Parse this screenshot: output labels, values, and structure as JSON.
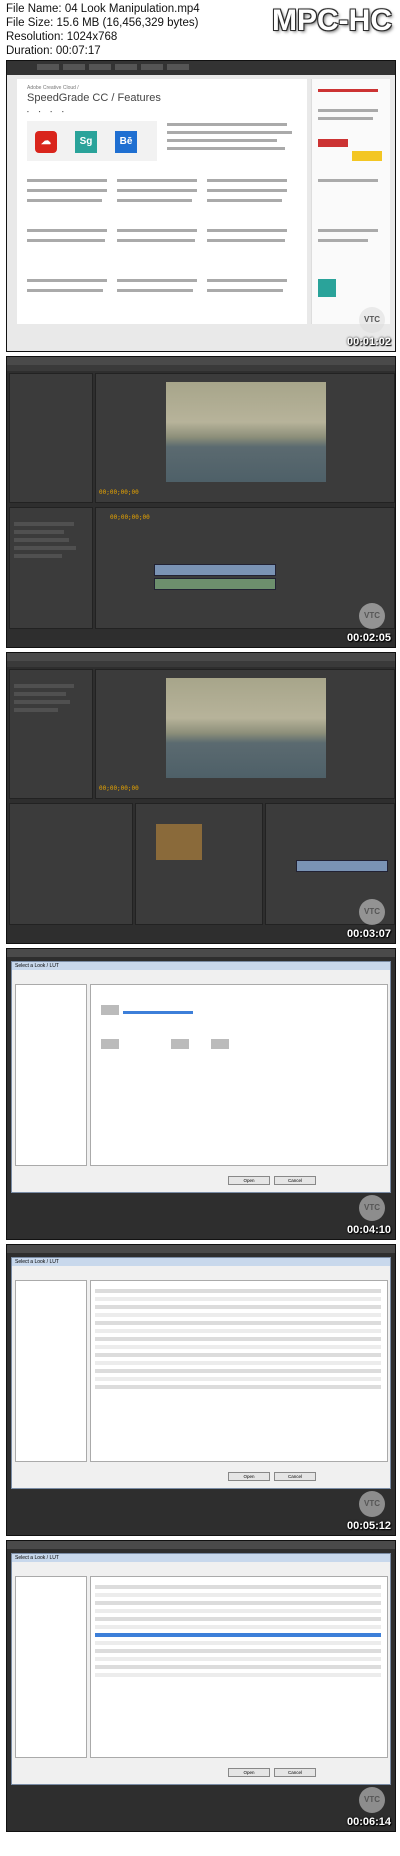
{
  "header": {
    "file_name_label": "File Name:",
    "file_name": "04 Look Manipulation.mp4",
    "file_size_label": "File Size:",
    "file_size": "15.6 MB (16,456,329 bytes)",
    "resolution_label": "Resolution:",
    "resolution": "1024x768",
    "duration_label": "Duration:",
    "duration": "00:07:17",
    "logo": "MPC-HC"
  },
  "thumbnails": [
    {
      "timestamp": "00:01:02",
      "page_title": "SpeedGrade CC / Features",
      "crumb": "Adobe Creative Cloud /",
      "apps": [
        "Sg",
        "Bē"
      ]
    },
    {
      "timestamp": "00:02:05",
      "timecode": "00;00;00;00"
    },
    {
      "timestamp": "00:03:07",
      "timecode": "00;00;00;00"
    },
    {
      "timestamp": "00:04:10",
      "dialog_title": "Select a Look / LUT",
      "open_button": "Open",
      "cancel_button": "Cancel"
    },
    {
      "timestamp": "00:05:12",
      "dialog_title": "Select a Look / LUT",
      "open_button": "Open",
      "cancel_button": "Cancel"
    },
    {
      "timestamp": "00:06:14",
      "dialog_title": "Select a Look / LUT",
      "open_button": "Open",
      "cancel_button": "Cancel"
    }
  ],
  "watermark": "VTC",
  "colors": {
    "accent_orange": "#e8a400",
    "app_red": "#d9251c",
    "app_teal": "#2aa39a",
    "app_blue": "#1f6fd1"
  }
}
